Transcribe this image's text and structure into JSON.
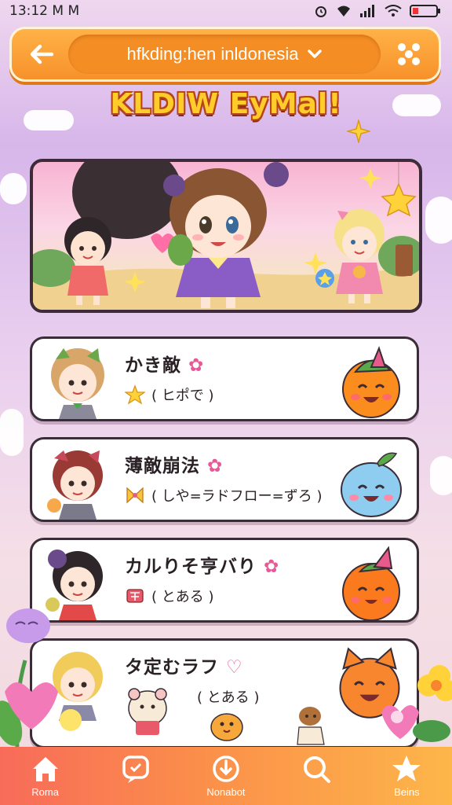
{
  "status_bar": {
    "time": "13:12 M M"
  },
  "search": {
    "query": "hfkding:hen inldonesia"
  },
  "hero": {
    "title": "KLDIW EyMal!"
  },
  "cards": [
    {
      "title": "かき敵",
      "title_mark": "✿",
      "subtitle": "( ヒポで )"
    },
    {
      "title": "薄敵崩法",
      "title_mark": "✿",
      "subtitle": "( しや=ラドフロー=ずろ )"
    },
    {
      "title": "カルりそ亨バり",
      "title_mark": "✿",
      "subtitle": "( とある )"
    },
    {
      "title": "タ定むラフ",
      "title_mark": "♡",
      "subtitle": "( とある )"
    }
  ],
  "nav": [
    {
      "label": "Roma",
      "icon": "home-icon"
    },
    {
      "label": "",
      "icon": "chat-icon"
    },
    {
      "label": "Nonabot",
      "icon": "notification-icon"
    },
    {
      "label": "",
      "icon": "search-icon"
    },
    {
      "label": "Beins",
      "icon": "star-icon"
    }
  ],
  "colors": {
    "top_bar": "#f7912a",
    "nav_start": "#f86b5a",
    "nav_end": "#fdb64a",
    "title_fill": "#ffcc2a",
    "title_outline": "#b5451c"
  }
}
